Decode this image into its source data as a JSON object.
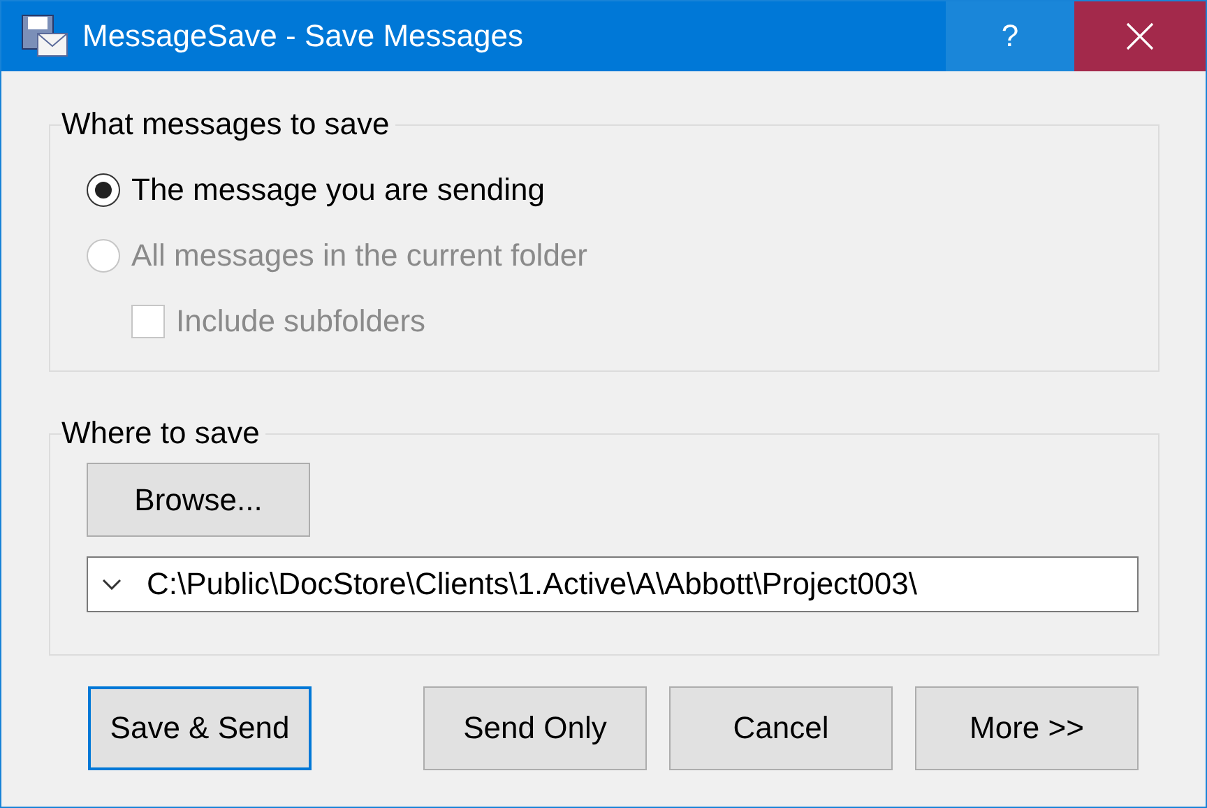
{
  "window": {
    "title": "MessageSave - Save Messages",
    "help_button": "?"
  },
  "what_to_save": {
    "title": "What messages to save",
    "options": [
      {
        "label": "The message you are sending",
        "selected": true,
        "disabled": false
      },
      {
        "label": "All messages in the current folder",
        "selected": false,
        "disabled": true
      }
    ],
    "include_subfolders": {
      "label": "Include subfolders",
      "checked": false,
      "disabled": true
    }
  },
  "where_to_save": {
    "title": "Where to save",
    "browse_button": "Browse...",
    "path": "C:\\Public\\DocStore\\Clients\\1.Active\\A\\Abbott\\Project003\\"
  },
  "buttons": [
    {
      "label": "Save & Send",
      "default": true
    },
    {
      "label": "Send Only",
      "default": false
    },
    {
      "label": "Cancel",
      "default": false
    },
    {
      "label": "More >>",
      "default": false
    }
  ]
}
